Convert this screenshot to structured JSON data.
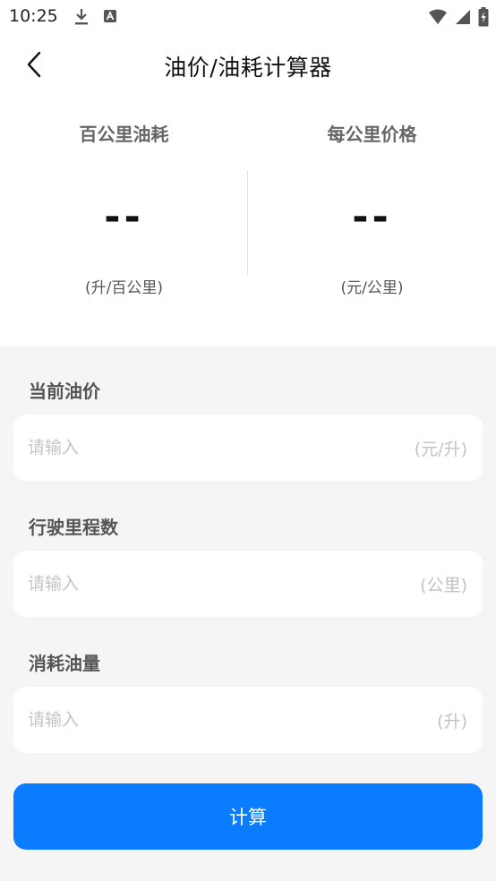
{
  "status_bar": {
    "time": "10:25",
    "left_icons": [
      "download-icon",
      "a-badge-icon"
    ],
    "right_icons": [
      "wifi-icon",
      "cell-signal-icon",
      "battery-charging-icon"
    ]
  },
  "header": {
    "back_icon": "chevron-left-icon",
    "title": "油价/油耗计算器"
  },
  "results": {
    "fuel_per_100km": {
      "label": "百公里油耗",
      "value": "--",
      "unit": "(升/百公里)"
    },
    "cost_per_km": {
      "label": "每公里价格",
      "value": "--",
      "unit": "(元/公里)"
    }
  },
  "form": {
    "fields": [
      {
        "label": "当前油价",
        "placeholder": "请输入",
        "value": "",
        "unit": "(元/升)"
      },
      {
        "label": "行驶里程数",
        "placeholder": "请输入",
        "value": "",
        "unit": "(公里)"
      },
      {
        "label": "消耗油量",
        "placeholder": "请输入",
        "value": "",
        "unit": "(升)"
      }
    ],
    "submit_label": "计算"
  },
  "colors": {
    "accent": "#0a7cff",
    "background": "#f5f5f5",
    "card": "#ffffff"
  }
}
